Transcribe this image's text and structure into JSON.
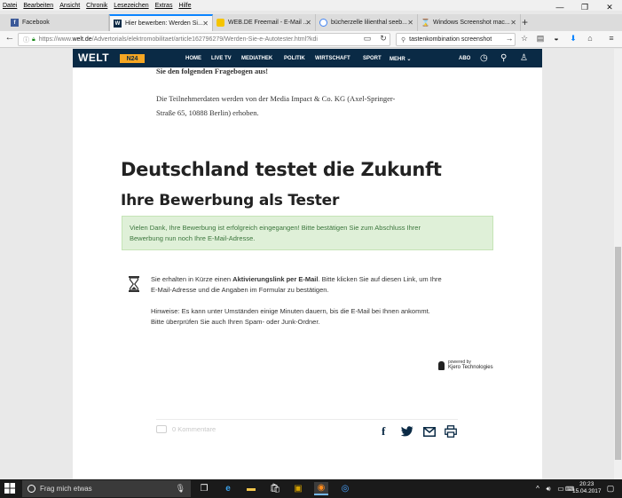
{
  "menubar": {
    "items": [
      "Datei",
      "Bearbeiten",
      "Ansicht",
      "Chronik",
      "Lesezeichen",
      "Extras",
      "Hilfe"
    ]
  },
  "window_controls": {
    "minimize": "—",
    "maximize": "❐",
    "close": "✕"
  },
  "tabs": [
    {
      "title": "Facebook",
      "favicon_color": "#3b5998",
      "favicon_letter": "f"
    },
    {
      "title": "Hier bewerben: Werden Si...",
      "favicon_color": "#0a2a45",
      "favicon_letter": "W"
    },
    {
      "title": "WEB.DE Freemail - E-Mail ...",
      "favicon_color": "#f5c400",
      "favicon_letter": ""
    },
    {
      "title": "bücherzelle lilienthal seeb...",
      "favicon_color": "#4285f4",
      "favicon_letter": ""
    },
    {
      "title": "Windows Screenshot mac...",
      "favicon_color": "#555555",
      "favicon_letter": ""
    }
  ],
  "address_bar": {
    "prefix": "https://www.",
    "domain": "welt.de",
    "path": "/Advertorials/elektromobilitaet/article162796279/Werden-Sie-e-Autotester.html?kdi"
  },
  "search_bar": {
    "value": "tastenkombination screenshot"
  },
  "welt_header": {
    "logo": "WELT",
    "n24": "N24",
    "nav": [
      "HOME",
      "LIVE TV",
      "MEDIATHEK",
      "POLITIK",
      "WIRTSCHAFT",
      "SPORT",
      "MEHR ⌄"
    ],
    "abo": "ABO"
  },
  "article": {
    "para1": "Sie den folgenden Fragebogen aus!",
    "para2_line1": "Die Teilnehmerdaten werden von der Media Impact & Co. KG  (Axel-Springer-",
    "para2_line2": "Straße 65, 10888 Berlin) erhoben.",
    "heading": "Deutschland testet die Zukunft",
    "subheading": "Ihre Bewerbung als Tester",
    "success_line1": "Vielen Dank, Ihre Bewerbung ist erfolgreich eingegangen! Bitte bestätigen Sie zum Abschluss Ihrer",
    "success_line2": "Bewerbung nun noch Ihre E-Mail-Adresse.",
    "info1_pre": "Sie erhalten in Kürze einen ",
    "info1_bold": "Aktivierungslink per E-Mail",
    "info1_post": ". Bitte klicken Sie auf diesen Link, um Ihre",
    "info1_line2": "E-Mail-Adresse und die Angaben im Formular zu bestätigen.",
    "info2_line1": "Hinweise: Es kann unter Umständen einige Minuten dauern, bis die E-Mail bei Ihnen ankommt.",
    "info2_line2": "Bitte überprüfen Sie auch Ihren Spam- oder Junk-Ordner.",
    "powered_by": "powered by",
    "powered_company": "Kjero Technologies",
    "comments": "0 Kommentare"
  },
  "share_icons": [
    "facebook-icon",
    "twitter-icon",
    "mail-icon",
    "print-icon"
  ],
  "taskbar": {
    "search_placeholder": "Frag mich etwas",
    "time": "20:23",
    "date": "15.04.2017"
  },
  "colors": {
    "welt_navy": "#0a2a45",
    "n24_orange": "#f5a623",
    "success_bg": "#dff0d8",
    "success_text": "#3c763d",
    "firefox_blue": "#0a84ff"
  }
}
